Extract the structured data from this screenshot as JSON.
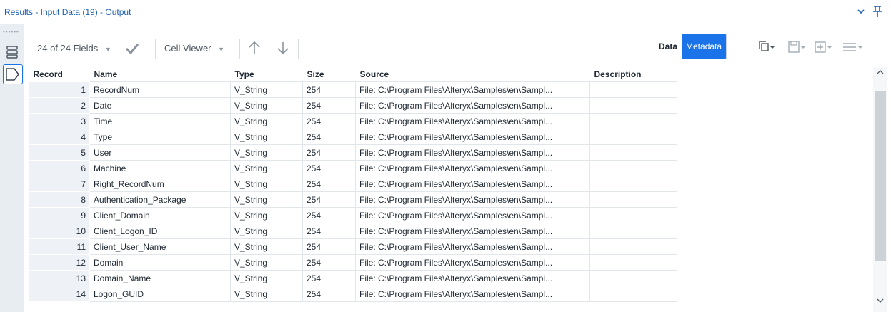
{
  "window": {
    "title": "Results - Input Data (19) - Output"
  },
  "toolbar": {
    "fields_label": "24 of 24 Fields",
    "cell_viewer_label": "Cell Viewer",
    "data_tab": "Data",
    "metadata_tab": "Metadata"
  },
  "table": {
    "columns": [
      "Record",
      "Name",
      "Type",
      "Size",
      "Source",
      "Description"
    ],
    "rows": [
      {
        "record": "1",
        "name": "RecordNum",
        "type": "V_String",
        "size": "254",
        "source": "File: C:\\Program Files\\Alteryx\\Samples\\en\\Sampl...",
        "description": ""
      },
      {
        "record": "2",
        "name": "Date",
        "type": "V_String",
        "size": "254",
        "source": "File: C:\\Program Files\\Alteryx\\Samples\\en\\Sampl...",
        "description": ""
      },
      {
        "record": "3",
        "name": "Time",
        "type": "V_String",
        "size": "254",
        "source": "File: C:\\Program Files\\Alteryx\\Samples\\en\\Sampl...",
        "description": ""
      },
      {
        "record": "4",
        "name": "Type",
        "type": "V_String",
        "size": "254",
        "source": "File: C:\\Program Files\\Alteryx\\Samples\\en\\Sampl...",
        "description": ""
      },
      {
        "record": "5",
        "name": "User",
        "type": "V_String",
        "size": "254",
        "source": "File: C:\\Program Files\\Alteryx\\Samples\\en\\Sampl...",
        "description": ""
      },
      {
        "record": "6",
        "name": "Machine",
        "type": "V_String",
        "size": "254",
        "source": "File: C:\\Program Files\\Alteryx\\Samples\\en\\Sampl...",
        "description": ""
      },
      {
        "record": "7",
        "name": "Right_RecordNum",
        "type": "V_String",
        "size": "254",
        "source": "File: C:\\Program Files\\Alteryx\\Samples\\en\\Sampl...",
        "description": ""
      },
      {
        "record": "8",
        "name": "Authentication_Package",
        "type": "V_String",
        "size": "254",
        "source": "File: C:\\Program Files\\Alteryx\\Samples\\en\\Sampl...",
        "description": ""
      },
      {
        "record": "9",
        "name": "Client_Domain",
        "type": "V_String",
        "size": "254",
        "source": "File: C:\\Program Files\\Alteryx\\Samples\\en\\Sampl...",
        "description": ""
      },
      {
        "record": "10",
        "name": "Client_Logon_ID",
        "type": "V_String",
        "size": "254",
        "source": "File: C:\\Program Files\\Alteryx\\Samples\\en\\Sampl...",
        "description": ""
      },
      {
        "record": "11",
        "name": "Client_User_Name",
        "type": "V_String",
        "size": "254",
        "source": "File: C:\\Program Files\\Alteryx\\Samples\\en\\Sampl...",
        "description": ""
      },
      {
        "record": "12",
        "name": "Domain",
        "type": "V_String",
        "size": "254",
        "source": "File: C:\\Program Files\\Alteryx\\Samples\\en\\Sampl...",
        "description": ""
      },
      {
        "record": "13",
        "name": "Domain_Name",
        "type": "V_String",
        "size": "254",
        "source": "File: C:\\Program Files\\Alteryx\\Samples\\en\\Sampl...",
        "description": ""
      },
      {
        "record": "14",
        "name": "Logon_GUID",
        "type": "V_String",
        "size": "254",
        "source": "File: C:\\Program Files\\Alteryx\\Samples\\en\\Sampl...",
        "description": ""
      }
    ]
  },
  "colors": {
    "accent": "#1a73e8",
    "title_text": "#1a5fb4"
  }
}
